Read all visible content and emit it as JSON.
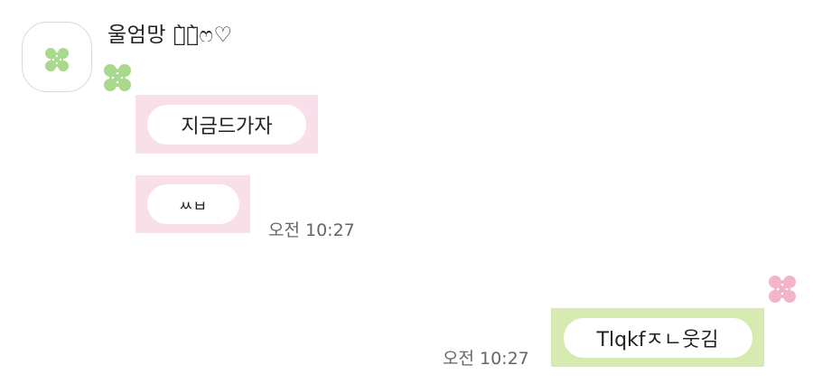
{
  "conversation": {
    "sender": {
      "name": "울엄망 ก̀ก̀ෆ♡",
      "avatar_icon": "clover-icon",
      "accent_color": "#a9d98c"
    },
    "received": [
      {
        "text": "지금드가자"
      },
      {
        "text": "ㅆㅂ",
        "time": "오전 10:27"
      }
    ],
    "sent": [
      {
        "text": "Tlqkfㅈㄴ웃김",
        "time": "오전 10:27"
      }
    ],
    "colors": {
      "received_bubble": "#f8dfea",
      "sent_bubble": "#d7ebb1",
      "clover_green": "#a9d98c",
      "clover_pink": "#f3b3cb"
    }
  }
}
